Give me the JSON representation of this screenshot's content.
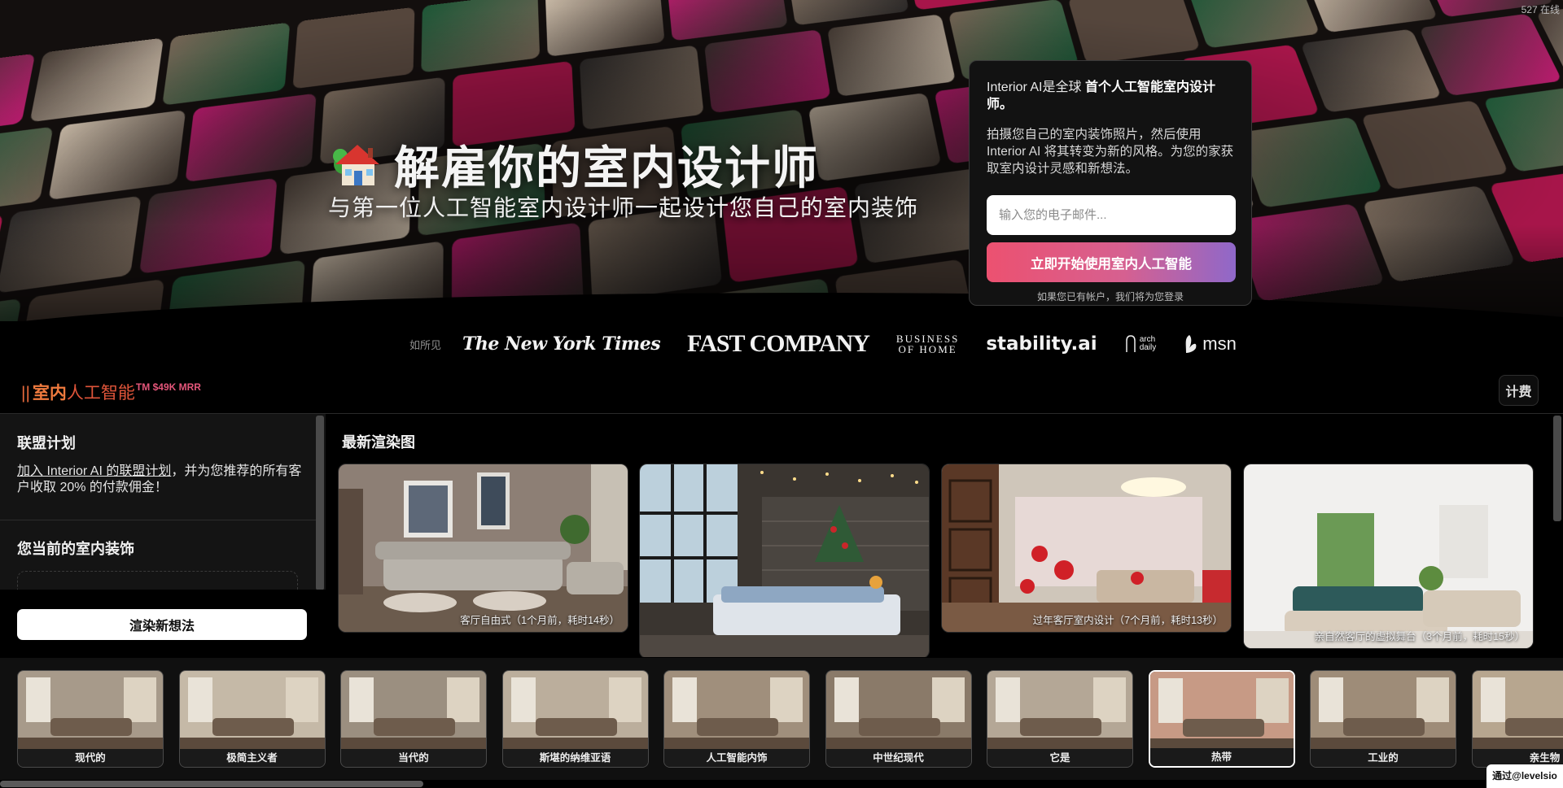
{
  "counter": "527 在线",
  "hero": {
    "title": "解雇你的室内设计师",
    "subtitle": "与第一位人工智能室内设计师一起设计您自己的室内装饰"
  },
  "signup": {
    "lead_prefix": "Interior AI是全球 ",
    "lead_bold": "首个人工智能室内设计师。",
    "description": "拍摄您自己的室内装饰照片，然后使用 Interior AI 将其转变为新的风格。为您的家获取室内设计灵感和新想法。",
    "email_placeholder": "输入您的电子邮件...",
    "cta_label": "立即开始使用室内人工智能",
    "note": "如果您已有帐户，我们将为您登录"
  },
  "press": {
    "label": "如所见",
    "nyt": "The New York Times",
    "fastcompany": "FAST COMPANY",
    "boh_line1": "BUSINESS",
    "boh_line2": "OF HOME",
    "stability": "stability.ai",
    "arch_line1": "arch",
    "arch_line2": "daily",
    "msn": "msn"
  },
  "brand": {
    "bars": "||",
    "name_a": "室内",
    "name_b": "人工智能",
    "tm": "TM",
    "mrr": "$49K MRR"
  },
  "nav": {
    "pricing": "计费"
  },
  "sidebar": {
    "affiliate_title": "联盟计划",
    "affiliate_link": "加入 Interior AI 的联盟计划",
    "affiliate_text": "，并为您推荐的所有客户收取 20% 的付款佣金！",
    "current_title": "您当前的室内装饰",
    "render_button": "渲染新想法"
  },
  "latest": {
    "title": "最新渲染图",
    "items": [
      {
        "caption": "客厅自由式（1个月前，耗时14秒）"
      },
      {
        "caption": ""
      },
      {
        "caption": "过年客厅室内设计（7个月前，耗时13秒）"
      },
      {
        "caption": "亲自然客厅的虚拟舞台（3个月前，耗时15秒）"
      }
    ]
  },
  "styles": [
    {
      "label": "现代的"
    },
    {
      "label": "极简主义者"
    },
    {
      "label": "当代的"
    },
    {
      "label": "斯堪的纳维亚语"
    },
    {
      "label": "人工智能内饰"
    },
    {
      "label": "中世纪现代"
    },
    {
      "label": "它是"
    },
    {
      "label": "热带",
      "selected": true
    },
    {
      "label": "工业的"
    },
    {
      "label": "亲生物"
    }
  ],
  "maker": "通过@levelsio",
  "colors": {
    "accent_orange": "#ef7a3e",
    "accent_pink": "#e4567a",
    "cta_start": "#ec5170",
    "cta_end": "#8f68c9"
  }
}
